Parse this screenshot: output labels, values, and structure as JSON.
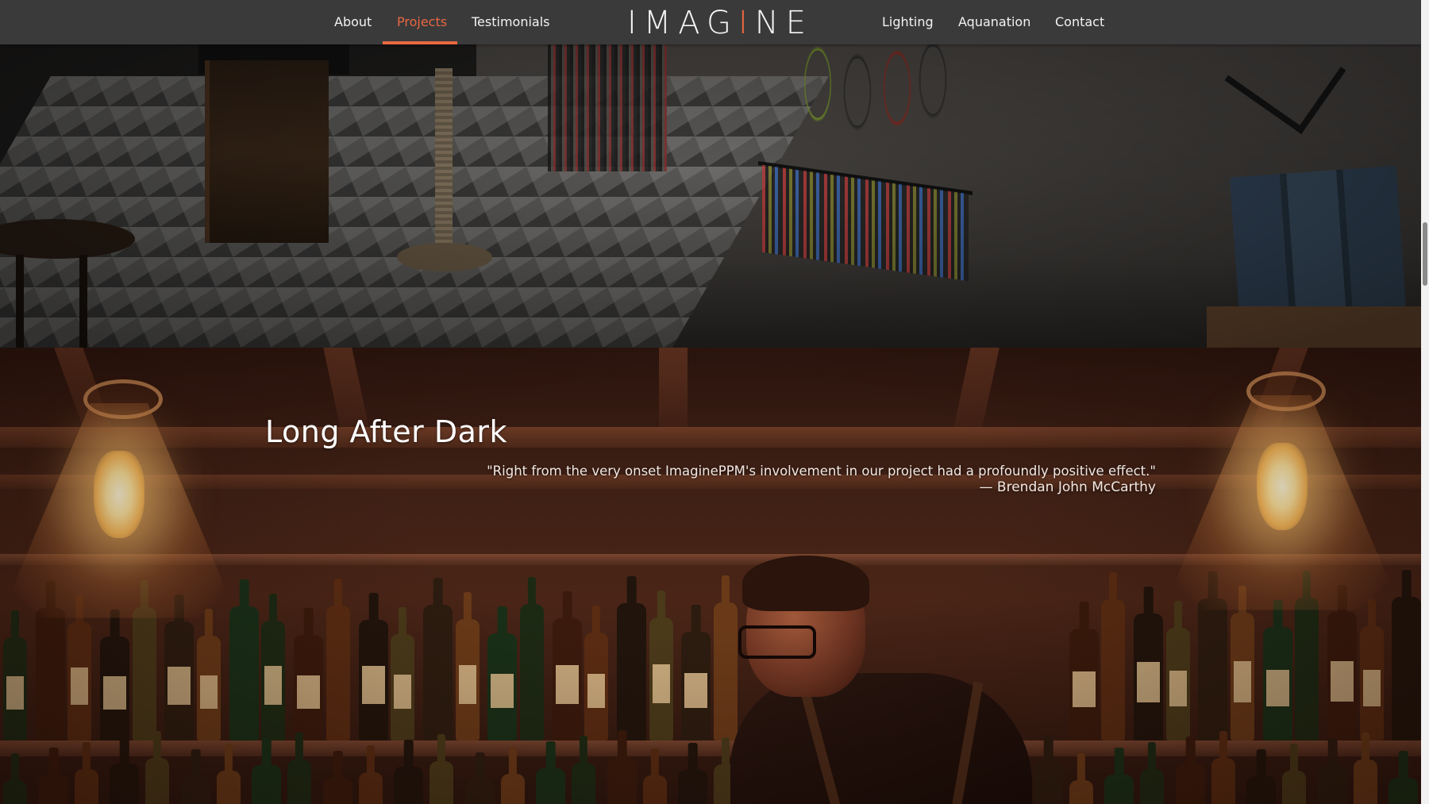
{
  "nav": {
    "items": [
      {
        "label": "About",
        "active": false
      },
      {
        "label": "Projects",
        "active": true
      },
      {
        "label": "Testimonials",
        "active": false
      },
      {
        "label": "Lighting",
        "active": false
      },
      {
        "label": "Aquanation",
        "active": false
      },
      {
        "label": "Contact",
        "active": false
      }
    ],
    "logo": {
      "before": "IMAG",
      "accent": "I",
      "after": "NE"
    }
  },
  "project": {
    "title": "Long After Dark",
    "quote": "\"Right from the very onset ImaginePPM's involvement in our project had a profoundly positive effect.\"",
    "author": "— Brendan John McCarthy"
  },
  "colors": {
    "accent": "#e8683f",
    "navbar": "#3a3a3b",
    "text": "#ffffff"
  }
}
